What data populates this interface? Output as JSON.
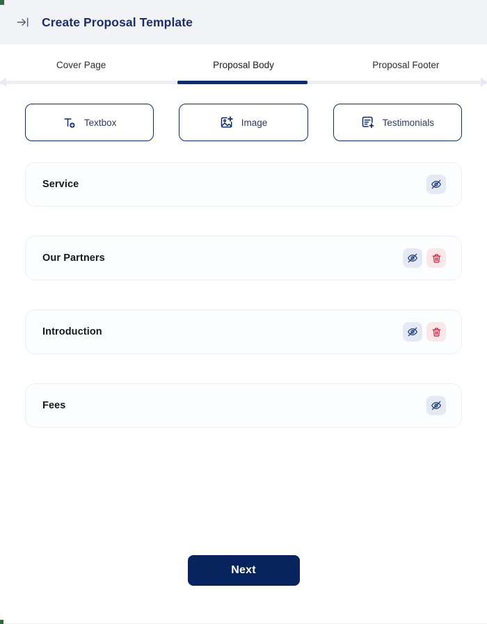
{
  "header": {
    "collapse_icon": "arrow-right-to-bar-icon",
    "title": "Create Proposal Template",
    "background_color": "#F1F3F7",
    "title_color": "#1C2F6B"
  },
  "tabs": {
    "active_index": 1,
    "indicator_color": "#0B2B6B",
    "items": [
      {
        "label": "Cover Page"
      },
      {
        "label": "Proposal Body"
      },
      {
        "label": "Proposal Footer"
      }
    ]
  },
  "add_blocks": {
    "items": [
      {
        "label": "Textbox",
        "icon": "text-add-icon"
      },
      {
        "label": "Image",
        "icon": "image-add-icon"
      },
      {
        "label": "Testimonials",
        "icon": "document-add-icon"
      }
    ],
    "border_color": "#0B2B6B",
    "label_color": "#2B3A63"
  },
  "sections": {
    "hide_icon": "eye-off-icon",
    "delete_icon": "trash-icon",
    "hide_button_bg": "#E4E9F3",
    "hide_icon_color": "#1B3A7A",
    "delete_button_bg": "#FBE6E9",
    "delete_icon_color": "#C0213A",
    "rows": [
      {
        "title": "Service",
        "can_hide": true,
        "can_delete": false
      },
      {
        "title": "Our Partners",
        "can_hide": true,
        "can_delete": true
      },
      {
        "title": "Introduction",
        "can_hide": true,
        "can_delete": true
      },
      {
        "title": "Fees",
        "can_hide": true,
        "can_delete": false
      }
    ]
  },
  "footer": {
    "next_label": "Next",
    "next_bg": "#07245F",
    "next_text_color": "#FFFFFF"
  }
}
